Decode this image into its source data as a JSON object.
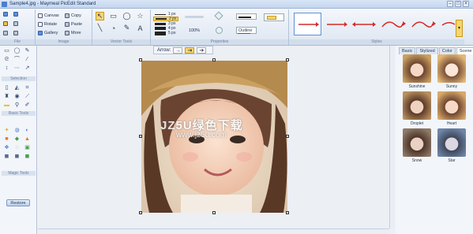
{
  "window": {
    "title": "Sample4.jpg - Maymeal PicEdit Standard"
  },
  "ribbon": {
    "groups": {
      "file": "File",
      "image": "Image",
      "vector_tools": "Vector Tools",
      "properties": "Properties",
      "styles": "Styles"
    },
    "image": {
      "canvas": "Canvas",
      "copy": "Copy",
      "rotate": "Rotate",
      "paste": "Paste",
      "gallery": "Gallery",
      "more": "More"
    },
    "line_widths": [
      "1 px",
      "2 px",
      "3 px",
      "4 px",
      "5 px"
    ],
    "zoom": "100%",
    "outline": "Outline"
  },
  "left_panel": {
    "sections": [
      "Selection",
      "Basic Tools",
      "Magic Tools"
    ],
    "restore": "Restore"
  },
  "canvas": {
    "arrow_label": "Arrow:"
  },
  "watermark": {
    "line1": "JZ5U绿色下载",
    "line2": "www.jz5u.com"
  },
  "right_panel": {
    "tabs": [
      "Basic",
      "Stylized",
      "Color",
      "Scene"
    ],
    "effects": [
      "Sunshine",
      "Sunny",
      "Droplet",
      "Heart",
      "Snow",
      "Star"
    ]
  },
  "colors": {
    "accent": "#f7d572",
    "arrow_red": "#d62a2a",
    "ribbon_bg": "#dde6f2"
  }
}
